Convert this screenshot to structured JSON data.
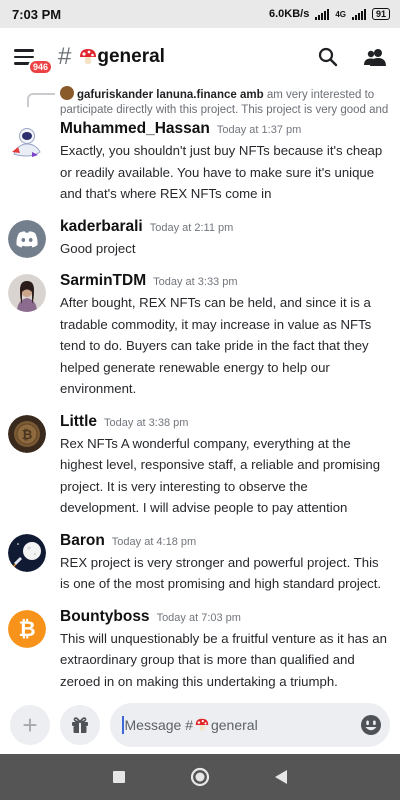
{
  "status_bar": {
    "time": "7:03 PM",
    "net_speed": "6.0KB/s",
    "network_type": "4G",
    "battery": "91"
  },
  "header": {
    "notification_count": "946",
    "hash_symbol": "#",
    "channel_name": "general",
    "channel_emoji": "mushroom-icon"
  },
  "reply": {
    "author": "gafuriskander lanuna.finance amb",
    "snippet": "am very interested to participate directly with this project. This project is very good and"
  },
  "messages": [
    {
      "author": "Muhammed_Hassan",
      "timestamp": "Today at 1:37 pm",
      "text": "Exactly, you shouldn't just buy NFTs because it's cheap or readily available.  You have to make sure it's unique and that's where REX NFTs come in",
      "avatar": "astronaut-avatar"
    },
    {
      "author": "kaderbarali",
      "timestamp": "Today at 2:11 pm",
      "text": "Good project",
      "avatar": "discord-default-avatar"
    },
    {
      "author": "SarminTDM",
      "timestamp": "Today at 3:33 pm",
      "text": "After bought, REX NFTs can be held, and since it is a tradable commodity, it may increase in value as NFTs tend to do. Buyers can take pride in the fact that they helped generate renewable energy to help our environment.",
      "avatar": "photo-avatar"
    },
    {
      "author": "Little",
      "timestamp": "Today at 3:38 pm",
      "text": "Rex NFTs A wonderful company, everything at the highest level, responsive staff, a reliable and promising project. It is very interesting to observe the development. I will advise people to pay attention",
      "avatar": "bitcoin-coin-avatar"
    },
    {
      "author": "Baron",
      "timestamp": "Today at 4:18 pm",
      "text": "REX  project is very stronger and powerful project. This is one of the most promising and high standard project.",
      "avatar": "moon-rocket-avatar"
    },
    {
      "author": "Bountyboss",
      "timestamp": "Today at 7:03 pm",
      "text": "This will unquestionably be a fruitful venture as it has an extraordinary group that is more than qualified and zeroed in on making this undertaking a triumph.",
      "avatar": "bitcoin-orange-avatar"
    }
  ],
  "composer": {
    "placeholder_prefix": "Message #",
    "placeholder_channel": "general"
  },
  "colors": {
    "badge": "#ed4245",
    "discord_blurple": "#5865f2",
    "bitcoin_orange": "#f7931a",
    "nav_bar": "#555556"
  }
}
